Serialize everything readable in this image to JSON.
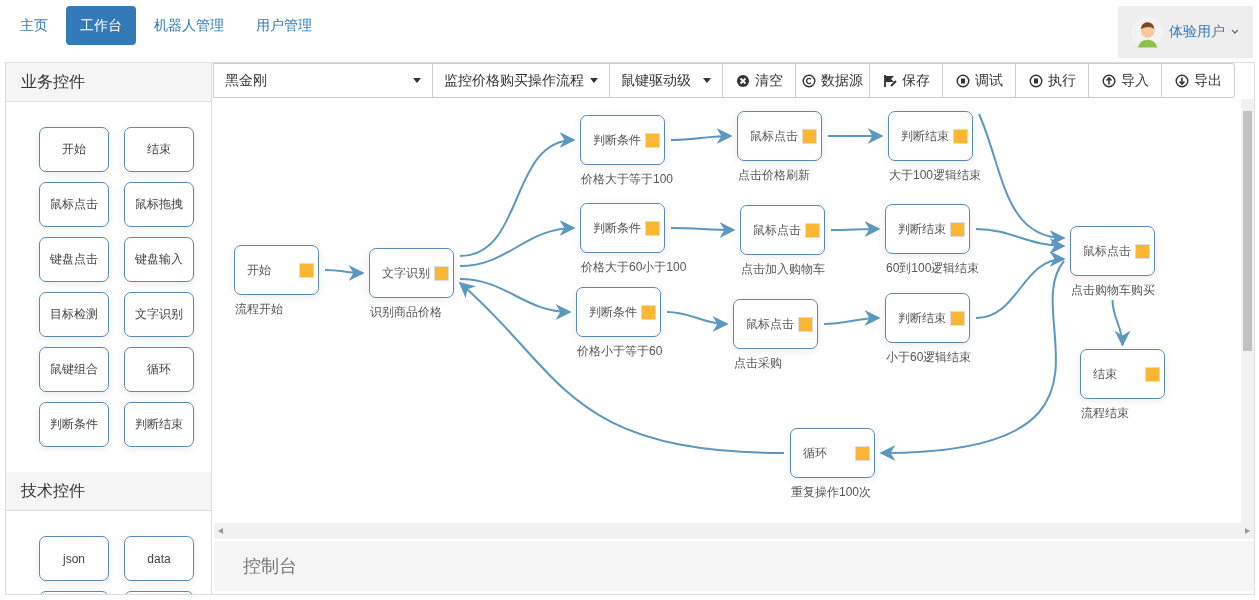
{
  "nav": {
    "items": [
      {
        "label": "主页",
        "selected": false
      },
      {
        "label": "工作台",
        "selected": true
      },
      {
        "label": "机器人管理",
        "selected": false
      },
      {
        "label": "用户管理",
        "selected": false
      }
    ],
    "user": {
      "name": "体验用户"
    }
  },
  "toolbar": {
    "dropdowns": [
      {
        "value": "黑金刚"
      },
      {
        "value": "监控价格购买操作流程"
      },
      {
        "value": "鼠键驱动级"
      }
    ],
    "buttons": [
      {
        "label": "清空",
        "kind": "clear"
      },
      {
        "label": "数据源",
        "kind": "source"
      },
      {
        "label": "保存",
        "kind": "save"
      },
      {
        "label": "调试",
        "kind": "debug"
      },
      {
        "label": "执行",
        "kind": "run"
      },
      {
        "label": "导入",
        "kind": "import"
      },
      {
        "label": "导出",
        "kind": "export"
      }
    ]
  },
  "sidebar": {
    "sections": [
      {
        "title": "业务控件",
        "items": [
          {
            "kind": "control",
            "label": "开始"
          },
          {
            "kind": "control",
            "label": "结束"
          },
          {
            "kind": "control",
            "label": "鼠标点击"
          },
          {
            "kind": "control",
            "label": "鼠标拖拽"
          },
          {
            "kind": "control",
            "label": "键盘点击"
          },
          {
            "kind": "control",
            "label": "键盘输入"
          },
          {
            "kind": "control",
            "label": "目标检测"
          },
          {
            "kind": "control",
            "label": "文字识别"
          },
          {
            "kind": "control",
            "label": "鼠键组合"
          },
          {
            "kind": "control",
            "label": "循环"
          },
          {
            "kind": "control",
            "label": "判断条件"
          },
          {
            "kind": "control",
            "label": "判断结束"
          }
        ]
      },
      {
        "title": "技术控件",
        "items": [
          {
            "kind": "control",
            "label": "json"
          },
          {
            "kind": "control",
            "label": "data"
          },
          {
            "kind": "cut-off"
          },
          {
            "kind": "cut-off"
          }
        ]
      }
    ]
  },
  "flow": {
    "nodes": [
      {
        "label": "开始",
        "caption": "流程开始"
      },
      {
        "label": "文字识别",
        "caption": "识别商品价格"
      },
      {
        "label": "判断条件",
        "caption": "价格大于等于100"
      },
      {
        "label": "判断条件",
        "caption": "价格大于60小于100"
      },
      {
        "label": "判断条件",
        "caption": "价格小于等于60"
      },
      {
        "label": "鼠标点击",
        "caption": "点击价格刷新"
      },
      {
        "label": "鼠标点击",
        "caption": "点击加入购物车"
      },
      {
        "label": "鼠标点击",
        "caption": "点击采购"
      },
      {
        "label": "判断结束",
        "caption": "大于100逻辑结束"
      },
      {
        "label": "判断结束",
        "caption": "60到100逻辑结束"
      },
      {
        "label": "判断结束",
        "caption": "小于60逻辑结束"
      },
      {
        "label": "鼠标点击",
        "caption": "点击购物车购买"
      },
      {
        "label": "结束",
        "caption": "流程结束"
      },
      {
        "label": "循环",
        "caption": "重复操作100次"
      }
    ]
  },
  "console": {
    "title": "控制台"
  }
}
